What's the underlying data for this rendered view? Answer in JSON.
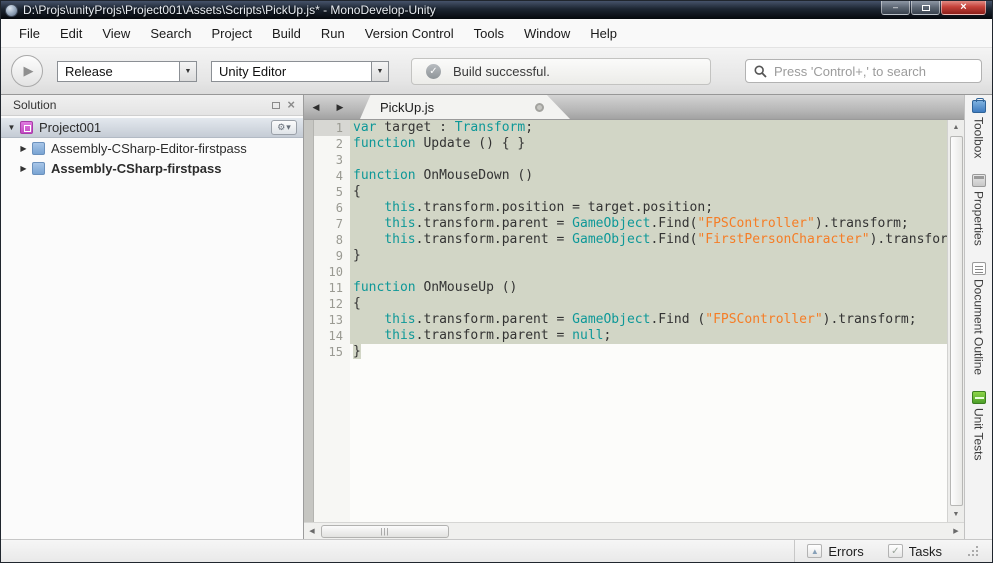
{
  "titlebar": {
    "title": "D:\\Projs\\unityProjs\\Project001\\Assets\\Scripts\\PickUp.js* - MonoDevelop-Unity"
  },
  "icons": {
    "minimize": "–",
    "close": "×",
    "play": "▶",
    "dropdown_arrow": "▼",
    "check": "✓",
    "gear": "⚙",
    "gear_caret": "▾",
    "expanded": "▼",
    "collapsed": "▶",
    "nav_left": "◀",
    "nav_right": "▶",
    "scroll_up": "▲",
    "scroll_down": "▼",
    "scroll_left": "◀",
    "scroll_right": "▶",
    "hthumb_grip": "|||",
    "errors_icon": "▲",
    "tasks_icon": "✓",
    "pad_close": "×"
  },
  "menubar": {
    "items": [
      "File",
      "Edit",
      "View",
      "Search",
      "Project",
      "Build",
      "Run",
      "Version Control",
      "Tools",
      "Window",
      "Help"
    ]
  },
  "toolbar": {
    "configuration": "Release",
    "target": "Unity Editor",
    "build_status": "Build successful.",
    "search_placeholder": "Press 'Control+,' to search"
  },
  "solution": {
    "title": "Solution",
    "tree": [
      {
        "label": "Project001",
        "icon": "project",
        "expander": "expanded",
        "selected": true,
        "gear": true,
        "indent": 0,
        "bold": false
      },
      {
        "label": "Assembly-CSharp-Editor-firstpass",
        "icon": "assembly",
        "expander": "collapsed",
        "selected": false,
        "gear": false,
        "indent": 1,
        "bold": false
      },
      {
        "label": "Assembly-CSharp-firstpass",
        "icon": "assembly",
        "expander": "collapsed",
        "selected": false,
        "gear": false,
        "indent": 1,
        "bold": true
      }
    ]
  },
  "editor": {
    "tab": "PickUp.js",
    "lines": [
      {
        "n": "1",
        "sel": "full",
        "cur": true,
        "tokens": [
          [
            "kw",
            "var"
          ],
          [
            "pl",
            " target : "
          ],
          [
            "kw",
            "Transform"
          ],
          [
            "pl",
            ";"
          ]
        ]
      },
      {
        "n": "2",
        "sel": "full",
        "cur": false,
        "tokens": [
          [
            "kw",
            "function"
          ],
          [
            "pl",
            " Update () { }"
          ]
        ]
      },
      {
        "n": "3",
        "sel": "full",
        "cur": false,
        "tokens": []
      },
      {
        "n": "4",
        "sel": "full",
        "cur": false,
        "tokens": [
          [
            "kw",
            "function"
          ],
          [
            "pl",
            " OnMouseDown ()"
          ]
        ]
      },
      {
        "n": "5",
        "sel": "full",
        "cur": false,
        "tokens": [
          [
            "pl",
            "{"
          ]
        ]
      },
      {
        "n": "6",
        "sel": "full",
        "cur": false,
        "tokens": [
          [
            "pl",
            "    "
          ],
          [
            "kw",
            "this"
          ],
          [
            "pl",
            ".transform.position = target.position;"
          ]
        ]
      },
      {
        "n": "7",
        "sel": "full",
        "cur": false,
        "tokens": [
          [
            "pl",
            "    "
          ],
          [
            "kw",
            "this"
          ],
          [
            "pl",
            ".transform.parent = "
          ],
          [
            "kw",
            "GameObject"
          ],
          [
            "pl",
            ".Find("
          ],
          [
            "str",
            "\"FPSController\""
          ],
          [
            "pl",
            ").transform;"
          ]
        ]
      },
      {
        "n": "8",
        "sel": "full",
        "cur": false,
        "tokens": [
          [
            "pl",
            "    "
          ],
          [
            "kw",
            "this"
          ],
          [
            "pl",
            ".transform.parent = "
          ],
          [
            "kw",
            "GameObject"
          ],
          [
            "pl",
            ".Find("
          ],
          [
            "str",
            "\"FirstPersonCharacter\""
          ],
          [
            "pl",
            ").transform;"
          ]
        ]
      },
      {
        "n": "9",
        "sel": "full",
        "cur": false,
        "tokens": [
          [
            "pl",
            "}"
          ]
        ]
      },
      {
        "n": "10",
        "sel": "full",
        "cur": false,
        "tokens": []
      },
      {
        "n": "11",
        "sel": "full",
        "cur": false,
        "tokens": [
          [
            "kw",
            "function"
          ],
          [
            "pl",
            " OnMouseUp ()"
          ]
        ]
      },
      {
        "n": "12",
        "sel": "full",
        "cur": false,
        "tokens": [
          [
            "pl",
            "{"
          ]
        ]
      },
      {
        "n": "13",
        "sel": "full",
        "cur": false,
        "tokens": [
          [
            "pl",
            "    "
          ],
          [
            "kw",
            "this"
          ],
          [
            "pl",
            ".transform.parent = "
          ],
          [
            "kw",
            "GameObject"
          ],
          [
            "pl",
            ".Find ("
          ],
          [
            "str",
            "\"FPSController\""
          ],
          [
            "pl",
            ").transform;"
          ]
        ]
      },
      {
        "n": "14",
        "sel": "full",
        "cur": false,
        "tokens": [
          [
            "pl",
            "    "
          ],
          [
            "kw",
            "this"
          ],
          [
            "pl",
            ".transform.parent = "
          ],
          [
            "kw",
            "null"
          ],
          [
            "pl",
            ";"
          ]
        ]
      },
      {
        "n": "15",
        "sel": "token",
        "cur": false,
        "tokens": [
          [
            "pl",
            "}"
          ]
        ]
      }
    ]
  },
  "dockstrip": {
    "tabs": [
      {
        "label": "Toolbox",
        "icon": "toolbox"
      },
      {
        "label": "Properties",
        "icon": "properties"
      },
      {
        "label": "Document Outline",
        "icon": "outline"
      },
      {
        "label": "Unit Tests",
        "icon": "unittests"
      }
    ]
  },
  "statusbar": {
    "errors_label": "Errors",
    "tasks_label": "Tasks"
  },
  "colors": {
    "keyword": "#0e9898",
    "string": "#f57d26",
    "selection": "#d2d6c6",
    "titlebar_dark": "#0a0f16",
    "selected_row": "#c5ccd5"
  }
}
